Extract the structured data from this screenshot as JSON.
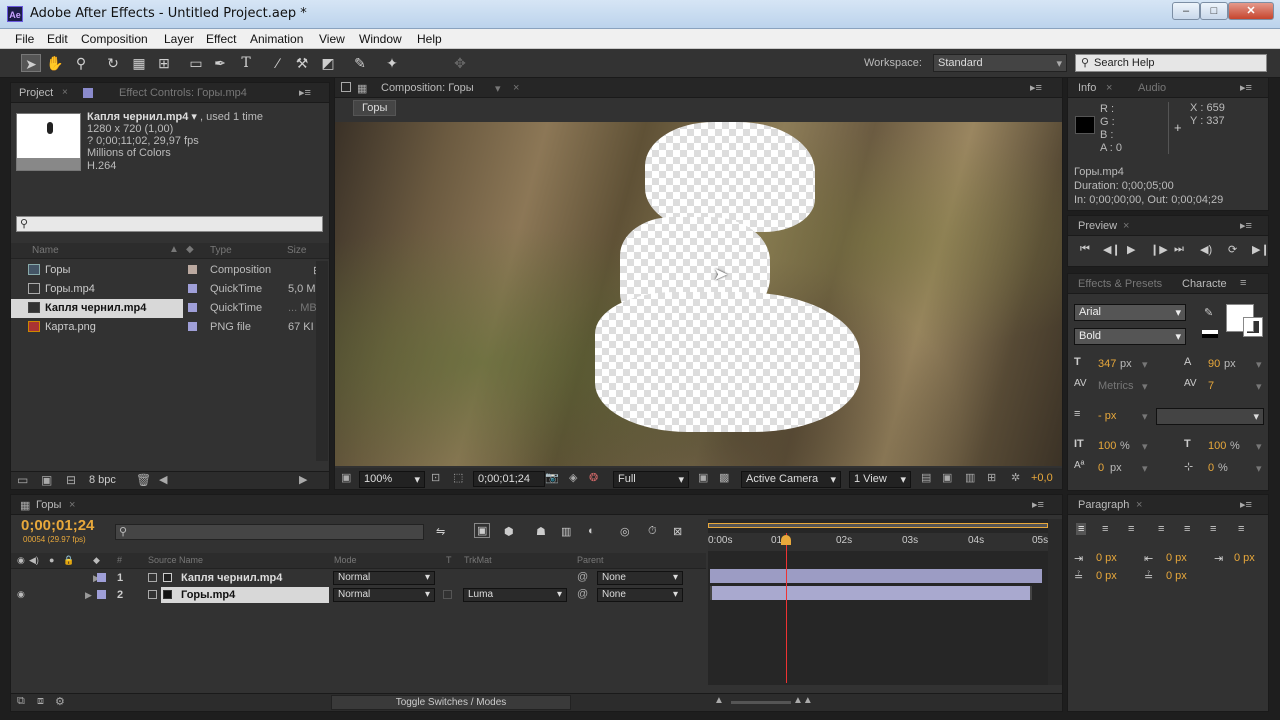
{
  "window": {
    "title": "Adobe After Effects - Untitled Project.aep *",
    "app_icon": "Ae",
    "minimize": "–",
    "maximize": "□",
    "close": "✕"
  },
  "menu": [
    "File",
    "Edit",
    "Composition",
    "Layer",
    "Effect",
    "Animation",
    "View",
    "Window",
    "Help"
  ],
  "toolbar": {
    "workspace_label": "Workspace:",
    "workspace_value": "Standard",
    "search_placeholder": "Search Help"
  },
  "project": {
    "tab": "Project",
    "effect_controls_tab": "Effect Controls: Горы.mp4",
    "selected_name": "Капля чернил.mp4",
    "selected_used": ", used 1 time",
    "info_lines": [
      "1280 x 720 (1,00)",
      "? 0;00;11;02, 29,97 fps",
      "Millions of Colors",
      "H.264"
    ],
    "search_placeholder": "",
    "columns": {
      "name": "Name",
      "type": "Type",
      "size": "Size"
    },
    "items": [
      {
        "name": "Горы",
        "type": "Composition",
        "size": "",
        "icon": "composition-icon"
      },
      {
        "name": "Горы.mp4",
        "type": "QuickTime",
        "size": "5,0 M",
        "icon": "footage-icon"
      },
      {
        "name": "Капля чернил.mp4",
        "type": "QuickTime",
        "size": "... MB",
        "icon": "footage-icon"
      },
      {
        "name": "Карта.png",
        "type": "PNG file",
        "size": "67 KI",
        "icon": "image-icon"
      }
    ],
    "bpc": "8 bpc"
  },
  "composition": {
    "tab": "Composition: Горы",
    "crumb": "Горы",
    "zoom": "100%",
    "timecode": "0;00;01;24",
    "resolution": "Full",
    "camera": "Active Camera",
    "views": "1 View",
    "exposure": "+0,0"
  },
  "info": {
    "tab": "Info",
    "audio_tab": "Audio",
    "rgba": [
      "R :",
      "G :",
      "B :",
      "A : 0"
    ],
    "x": "X : 659",
    "y": "Y : 337",
    "layer": "Горы.mp4",
    "duration": "Duration: 0;00;05;00",
    "inout": "In: 0;00;00;00, Out: 0;00;04;29"
  },
  "preview": {
    "tab": "Preview"
  },
  "character": {
    "effects_tab": "Effects & Presets",
    "char_tab": "Characte",
    "font": "Arial",
    "style": "Bold",
    "size": "347",
    "size_unit": "px",
    "leading": "90",
    "leading_unit": "px",
    "kerning": "Metrics",
    "tracking": "7",
    "stroke_width": "- px",
    "vscale": "100",
    "vscale_unit": "%",
    "hscale": "100",
    "hscale_unit": "%",
    "baseline": "0",
    "baseline_unit": "px",
    "tsume": "0",
    "tsume_unit": "%"
  },
  "paragraph": {
    "tab": "Paragraph",
    "values": [
      "0 px",
      "0 px",
      "0 px",
      "0 px",
      "0 px"
    ]
  },
  "timeline": {
    "tab": "Горы",
    "timecode": "0;00;01;24",
    "fps": "00054 (29.97 fps)",
    "columns": {
      "num": "#",
      "source": "Source Name",
      "mode": "Mode",
      "t": "T",
      "trkmat": "TrkMat",
      "parent": "Parent"
    },
    "layers": [
      {
        "num": "1",
        "name": "Капля чернил.mp4",
        "mode": "Normal",
        "trkmat": "",
        "parent": "None"
      },
      {
        "num": "2",
        "name": "Горы.mp4",
        "mode": "Normal",
        "trkmat": "Luma",
        "parent": "None"
      }
    ],
    "ruler": [
      "0:00s",
      "01s",
      "02s",
      "03s",
      "04s",
      "05s"
    ],
    "toggle": "Toggle Switches / Modes",
    "playhead_fraction": 0.23
  }
}
